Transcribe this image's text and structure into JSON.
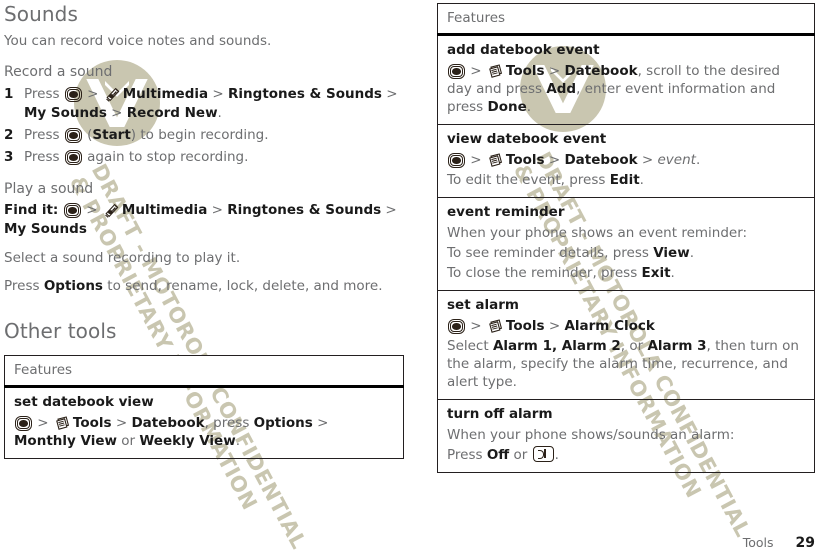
{
  "document": {
    "footer": {
      "chapter": "Tools",
      "page_number": "29"
    },
    "watermark": {
      "line1": "DRAFT - MOTOROLA CONFIDENTIAL",
      "line2": "& PROPRIETARY INFORMATION",
      "color": "#c9c6b0",
      "logo": "motorola-m-logo"
    }
  },
  "left_column": {
    "heading": "Sounds",
    "intro": "You can record voice notes and sounds.",
    "record_section": {
      "subhead": "Record a sound",
      "steps": [
        {
          "num": "1",
          "parts": [
            {
              "t": "text",
              "v": "Press "
            },
            {
              "t": "icon",
              "v": "center-key-icon"
            },
            {
              "t": "sep",
              "v": " > "
            },
            {
              "t": "icon",
              "v": "multimedia-icon"
            },
            {
              "t": "bold",
              "v": "Multimedia"
            },
            {
              "t": "sep",
              "v": " > "
            },
            {
              "t": "bold",
              "v": "Ringtones & Sounds"
            },
            {
              "t": "sep",
              "v": " > "
            },
            {
              "t": "bold",
              "v": "My Sounds"
            },
            {
              "t": "sep",
              "v": " > "
            },
            {
              "t": "bold",
              "v": "Record New"
            },
            {
              "t": "text",
              "v": "."
            }
          ]
        },
        {
          "num": "2",
          "parts": [
            {
              "t": "text",
              "v": "Press "
            },
            {
              "t": "icon",
              "v": "center-key-icon"
            },
            {
              "t": "text",
              "v": " ("
            },
            {
              "t": "bold",
              "v": "Start"
            },
            {
              "t": "text",
              "v": ") to begin recording."
            }
          ]
        },
        {
          "num": "3",
          "parts": [
            {
              "t": "text",
              "v": "Press "
            },
            {
              "t": "icon",
              "v": "center-key-icon"
            },
            {
              "t": "text",
              "v": " again to stop recording."
            }
          ]
        }
      ]
    },
    "play_section": {
      "subhead": "Play a sound",
      "find_it_label": "Find it:",
      "find_it_parts": [
        {
          "t": "icon",
          "v": "center-key-icon"
        },
        {
          "t": "sep",
          "v": " > "
        },
        {
          "t": "icon",
          "v": "multimedia-icon"
        },
        {
          "t": "bold",
          "v": "Multimedia"
        },
        {
          "t": "sep",
          "v": " > "
        },
        {
          "t": "bold",
          "v": "Ringtones & Sounds"
        },
        {
          "t": "sep",
          "v": " > "
        },
        {
          "t": "bold",
          "v": "My Sounds"
        }
      ],
      "para1": "Select a sound recording to play it.",
      "para2_parts": [
        {
          "t": "text",
          "v": "Press "
        },
        {
          "t": "bold",
          "v": "Options"
        },
        {
          "t": "text",
          "v": " to send, rename, lock, delete, and more."
        }
      ]
    },
    "other_tools": {
      "heading": "Other tools",
      "table": {
        "header": "Features",
        "rows": [
          {
            "title": "set datebook view",
            "lines": [
              [
                {
                  "t": "icon",
                  "v": "center-key-icon"
                },
                {
                  "t": "sep",
                  "v": " > "
                },
                {
                  "t": "icon",
                  "v": "tools-icon"
                },
                {
                  "t": "bold",
                  "v": "Tools"
                },
                {
                  "t": "sep",
                  "v": " > "
                },
                {
                  "t": "bold",
                  "v": "Datebook"
                },
                {
                  "t": "text",
                  "v": ", press "
                },
                {
                  "t": "bold",
                  "v": "Options"
                },
                {
                  "t": "sep",
                  "v": " > "
                },
                {
                  "t": "bold",
                  "v": "Monthly View"
                },
                {
                  "t": "text",
                  "v": " or "
                },
                {
                  "t": "bold",
                  "v": "Weekly View"
                },
                {
                  "t": "text",
                  "v": "."
                }
              ]
            ]
          }
        ]
      }
    }
  },
  "right_column": {
    "table": {
      "header": "Features",
      "rows": [
        {
          "title": "add datebook event",
          "lines": [
            [
              {
                "t": "icon",
                "v": "center-key-icon"
              },
              {
                "t": "sep",
                "v": " > "
              },
              {
                "t": "icon",
                "v": "tools-icon"
              },
              {
                "t": "bold",
                "v": "Tools"
              },
              {
                "t": "sep",
                "v": " > "
              },
              {
                "t": "bold",
                "v": "Datebook"
              },
              {
                "t": "text",
                "v": ", scroll to the desired day and press "
              },
              {
                "t": "bold",
                "v": "Add"
              },
              {
                "t": "text",
                "v": ", enter event information and press "
              },
              {
                "t": "bold",
                "v": "Done"
              },
              {
                "t": "text",
                "v": "."
              }
            ]
          ]
        },
        {
          "title": "view datebook event",
          "lines": [
            [
              {
                "t": "icon",
                "v": "center-key-icon"
              },
              {
                "t": "sep",
                "v": " > "
              },
              {
                "t": "icon",
                "v": "tools-icon"
              },
              {
                "t": "bold",
                "v": "Tools"
              },
              {
                "t": "sep",
                "v": " > "
              },
              {
                "t": "bold",
                "v": "Datebook"
              },
              {
                "t": "sep",
                "v": " > "
              },
              {
                "t": "italic",
                "v": "event"
              },
              {
                "t": "text",
                "v": "."
              }
            ],
            [
              {
                "t": "text",
                "v": "To edit the event, press "
              },
              {
                "t": "bold",
                "v": "Edit"
              },
              {
                "t": "text",
                "v": "."
              }
            ]
          ]
        },
        {
          "title": "event reminder",
          "lines": [
            [
              {
                "t": "text",
                "v": "When your phone shows an event reminder:"
              }
            ],
            [
              {
                "t": "text",
                "v": "To see reminder details, press "
              },
              {
                "t": "bold",
                "v": "View"
              },
              {
                "t": "text",
                "v": "."
              }
            ],
            [
              {
                "t": "text",
                "v": "To close the reminder, press "
              },
              {
                "t": "bold",
                "v": "Exit"
              },
              {
                "t": "text",
                "v": "."
              }
            ]
          ]
        },
        {
          "title": "set alarm",
          "lines": [
            [
              {
                "t": "icon",
                "v": "center-key-icon"
              },
              {
                "t": "sep",
                "v": " > "
              },
              {
                "t": "icon",
                "v": "tools-icon"
              },
              {
                "t": "bold",
                "v": "Tools"
              },
              {
                "t": "sep",
                "v": " > "
              },
              {
                "t": "bold",
                "v": "Alarm Clock"
              }
            ],
            [
              {
                "t": "text",
                "v": "Select "
              },
              {
                "t": "bold",
                "v": "Alarm 1, Alarm 2"
              },
              {
                "t": "text",
                "v": ", or "
              },
              {
                "t": "bold",
                "v": "Alarm 3"
              },
              {
                "t": "text",
                "v": ", then turn on the alarm, specify the alarm time, recurrence, and alert type."
              }
            ]
          ]
        },
        {
          "title": "turn off alarm",
          "lines": [
            [
              {
                "t": "text",
                "v": "When your phone shows/sounds an alarm:"
              }
            ],
            [
              {
                "t": "text",
                "v": "Press "
              },
              {
                "t": "bold",
                "v": "Off"
              },
              {
                "t": "text",
                "v": " or "
              },
              {
                "t": "icon",
                "v": "end-key-icon"
              },
              {
                "t": "text",
                "v": "."
              }
            ]
          ]
        }
      ]
    }
  }
}
